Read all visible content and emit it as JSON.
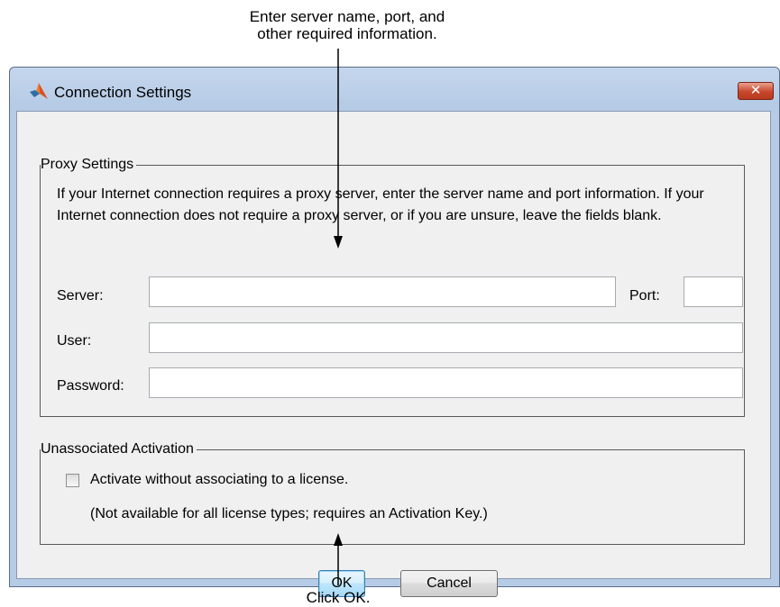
{
  "callouts": {
    "top_line1": "Enter server name, port, and",
    "top_line2": "other required information.",
    "bottom": "Click OK."
  },
  "window": {
    "title": "Connection Settings",
    "close_label": "✕",
    "app_icon": "matlab-logo-icon"
  },
  "proxy": {
    "legend": "Proxy Settings",
    "description": "If your Internet connection requires a proxy server, enter the server name and port information. If your Internet connection does not require a proxy server, or if you are unsure, leave the fields blank.",
    "server_label": "Server:",
    "server_value": "",
    "port_label": "Port:",
    "port_value": "",
    "user_label": "User:",
    "user_value": "",
    "password_label": "Password:",
    "password_value": ""
  },
  "activation": {
    "legend": "Unassociated Activation",
    "checkbox_label": "Activate without associating to a license.",
    "checked": false,
    "note": "(Not available for all license types; requires an Activation Key.)"
  },
  "buttons": {
    "ok": "OK",
    "cancel": "Cancel"
  },
  "colors": {
    "title_bar": "#b9cde8",
    "client_bg": "#f0f0f0",
    "close_button": "#c8472c",
    "ok_focus": "#3c7fb1"
  }
}
